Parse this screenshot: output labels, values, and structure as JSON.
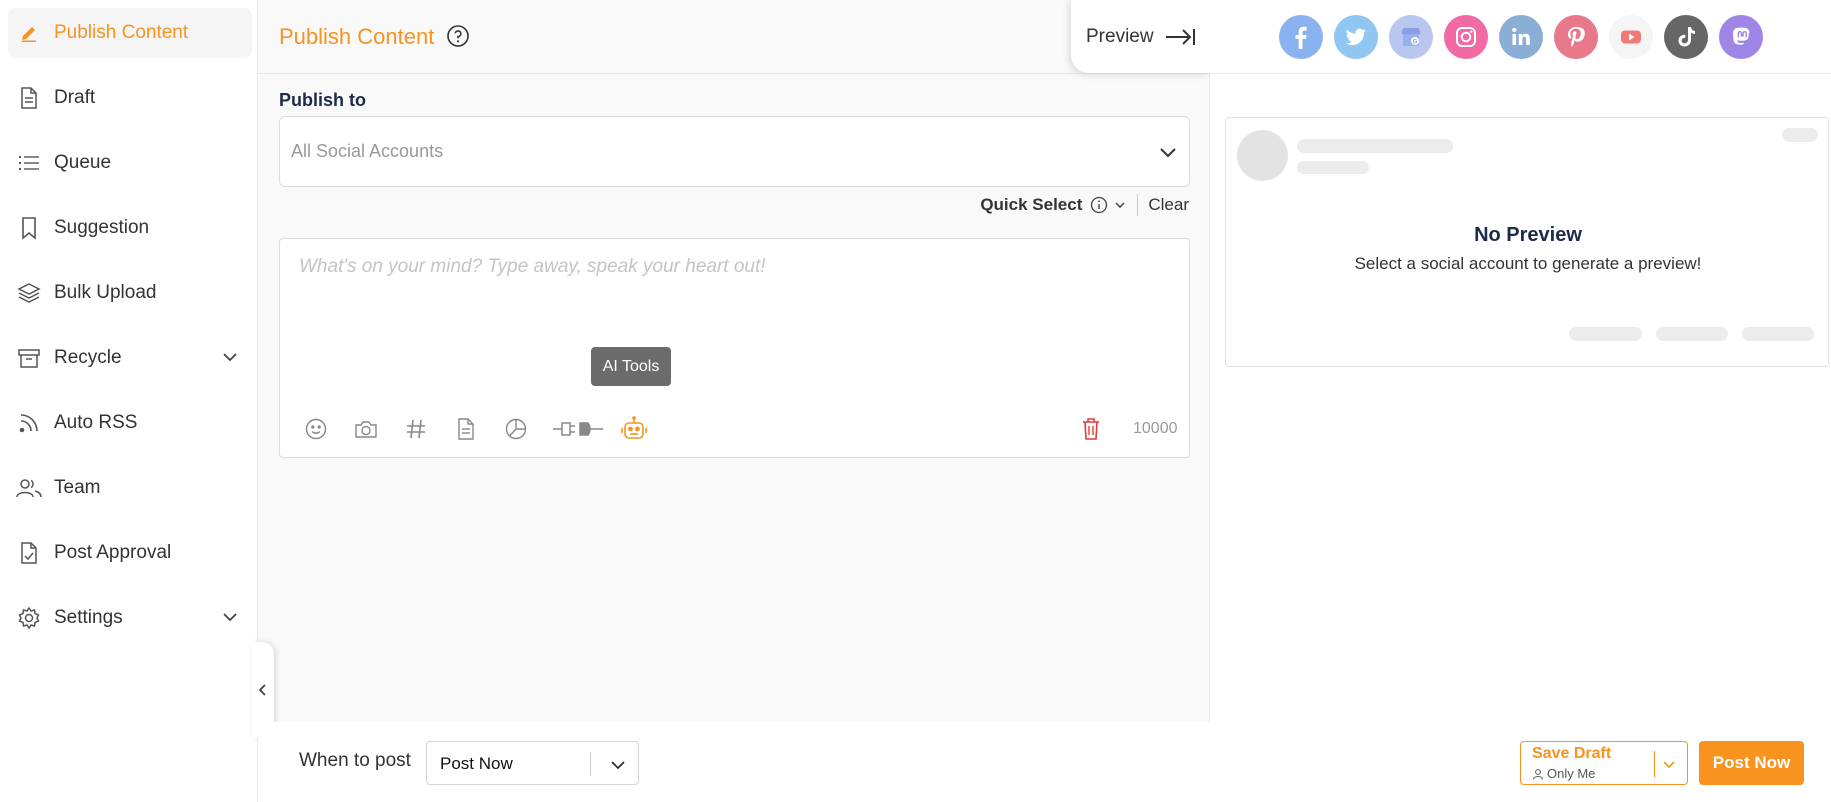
{
  "sidebar": {
    "items": [
      {
        "label": "Publish Content",
        "icon": "pencil-icon",
        "active": true
      },
      {
        "label": "Draft",
        "icon": "document-icon"
      },
      {
        "label": "Queue",
        "icon": "list-icon"
      },
      {
        "label": "Suggestion",
        "icon": "bookmark-icon"
      },
      {
        "label": "Bulk Upload",
        "icon": "layers-icon"
      },
      {
        "label": "Recycle",
        "icon": "archive-icon",
        "expandable": true
      },
      {
        "label": "Auto RSS",
        "icon": "rss-icon"
      },
      {
        "label": "Team",
        "icon": "team-icon"
      },
      {
        "label": "Post Approval",
        "icon": "approval-icon"
      },
      {
        "label": "Settings",
        "icon": "gear-icon",
        "expandable": true
      }
    ]
  },
  "header": {
    "title": "Publish Content",
    "preview_label": "Preview"
  },
  "publish": {
    "label": "Publish to",
    "placeholder": "All Social Accounts",
    "quick_select_label": "Quick Select",
    "clear_label": "Clear"
  },
  "composer": {
    "placeholder": "What's on your mind? Type away, speak your heart out!",
    "ai_tooltip": "AI Tools",
    "char_count": "10000"
  },
  "social_networks": [
    {
      "name": "facebook-icon",
      "color": "#8ab1f0"
    },
    {
      "name": "twitter-icon",
      "color": "#8fc7f2"
    },
    {
      "name": "google-business-icon",
      "color": "#b9c6f0"
    },
    {
      "name": "instagram-icon",
      "color": "#f06aa4"
    },
    {
      "name": "linkedin-icon",
      "color": "#8aaed6"
    },
    {
      "name": "pinterest-icon",
      "color": "#e8798a"
    },
    {
      "name": "youtube-icon",
      "color": "#f5f5f5"
    },
    {
      "name": "tiktok-icon",
      "color": "#666666"
    },
    {
      "name": "mastodon-icon",
      "color": "#9f86e6"
    }
  ],
  "preview": {
    "title": "No Preview",
    "subtitle": "Select a social account to generate a preview!"
  },
  "footer": {
    "when_label": "When to post",
    "when_value": "Post Now",
    "save_draft_label": "Save Draft",
    "save_draft_visibility": "Only Me",
    "post_now_label": "Post Now"
  },
  "colors": {
    "accent": "#f7931e",
    "navy": "#1e2a4a"
  }
}
